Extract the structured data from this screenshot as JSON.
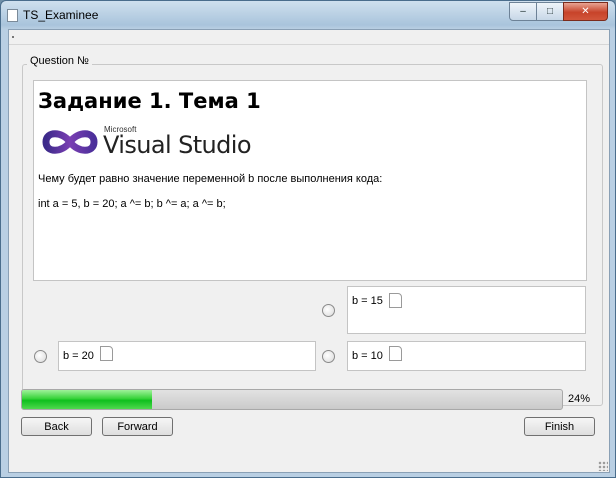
{
  "window": {
    "title": "TS_Examinee",
    "controls": {
      "minimize": "–",
      "maximize": "□",
      "close": "✕"
    }
  },
  "question_group": {
    "label": "Question №",
    "heading": "Задание 1. Тема 1",
    "logo": {
      "brand": "Microsoft",
      "product": "Visual Studio"
    },
    "text_lines": [
      "Чему будет равно значение переменной b после выполнения кода:",
      "int a = 5, b = 20; a ^= b; b ^= a; a ^= b;"
    ]
  },
  "answers": [
    {
      "label": "b = 15"
    },
    {
      "label": "b = 20"
    },
    {
      "label": "b = 10"
    }
  ],
  "progress": {
    "value": 0.24,
    "label": "24%"
  },
  "buttons": {
    "back": "Back",
    "forward": "Forward",
    "finish": "Finish"
  },
  "colors": {
    "progress_green": "#22c72a",
    "title_bar": "#b9cfe3"
  }
}
